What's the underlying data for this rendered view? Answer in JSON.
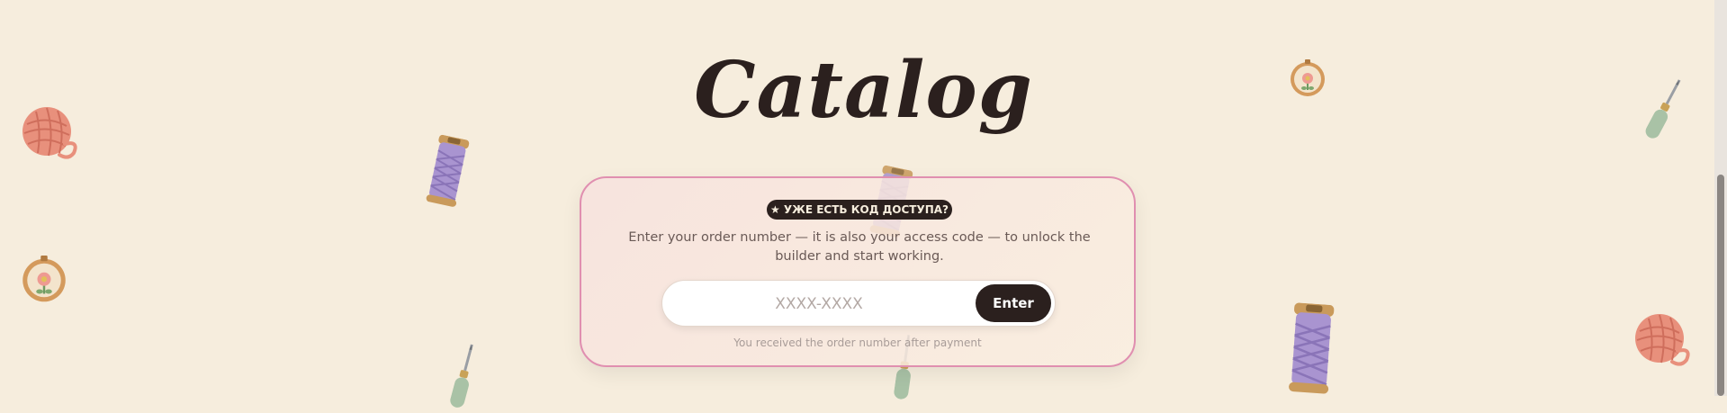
{
  "page": {
    "title": "Catalog"
  },
  "access_card": {
    "badge": "★ УЖЕ ЕСТЬ КОД ДОСТУПА?",
    "description": "Enter your order number — it is also your access code — to unlock the builder and start working.",
    "input": {
      "placeholder": "XXXX-XXXX",
      "value": ""
    },
    "enter_label": "Enter",
    "hint": "You received the order number after payment"
  },
  "decorations": [
    "yarn-ball-icon",
    "thread-spool-icon",
    "embroidery-hoop-icon",
    "punch-needle-icon"
  ],
  "colors": {
    "background": "#f6eddd",
    "dark": "#2b201e",
    "card_border": "#e08fb0",
    "yarn": "#e88d7a",
    "spool_thread": "#a994d0",
    "handle": "#a9c2a6"
  }
}
